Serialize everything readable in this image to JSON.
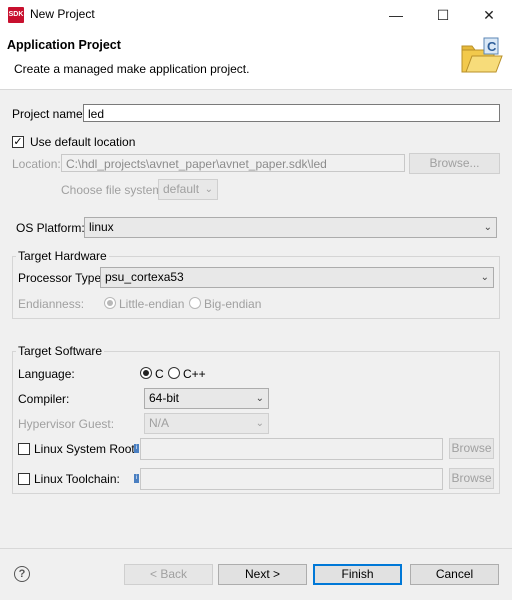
{
  "window": {
    "title": "New Project",
    "app_icon_text": "SDK",
    "minimize_glyph": "—",
    "maximize_glyph": "☐",
    "close_glyph": "✕"
  },
  "header": {
    "title": "Application Project",
    "description": "Create a managed make application project."
  },
  "project": {
    "name_label": "Project name:",
    "name_value": "led",
    "use_default_label": "Use default location",
    "use_default_checked": true,
    "location_label": "Location:",
    "location_value": "C:\\hdl_projects\\avnet_paper\\avnet_paper.sdk\\led",
    "browse_label": "Browse...",
    "file_system_label": "Choose file system:",
    "file_system_value": "default"
  },
  "os": {
    "label": "OS Platform:",
    "value": "linux"
  },
  "target_hardware": {
    "title": "Target Hardware",
    "processor_label": "Processor Type:",
    "processor_value": "psu_cortexa53",
    "endianness_label": "Endianness:",
    "little_endian_label": "Little-endian",
    "big_endian_label": "Big-endian",
    "selected_endianness": "Little-endian"
  },
  "target_software": {
    "title": "Target Software",
    "language_label": "Language:",
    "lang_c_label": "C",
    "lang_cpp_label": "C++",
    "selected_language": "C",
    "compiler_label": "Compiler:",
    "compiler_value": "64-bit",
    "hypervisor_label": "Hypervisor Guest:",
    "hypervisor_value": "N/A",
    "sysroot_label": "Linux System Root:",
    "sysroot_browse": "Browse",
    "toolchain_label": "Linux Toolchain:",
    "toolchain_browse": "Browse"
  },
  "footer": {
    "help_glyph": "?",
    "back_label": "< Back",
    "next_label": "Next >",
    "finish_label": "Finish",
    "cancel_label": "Cancel"
  },
  "colors": {
    "accent": "#0078d7",
    "app_icon": "#c8102e",
    "info_marker": "#4a7fc1"
  }
}
